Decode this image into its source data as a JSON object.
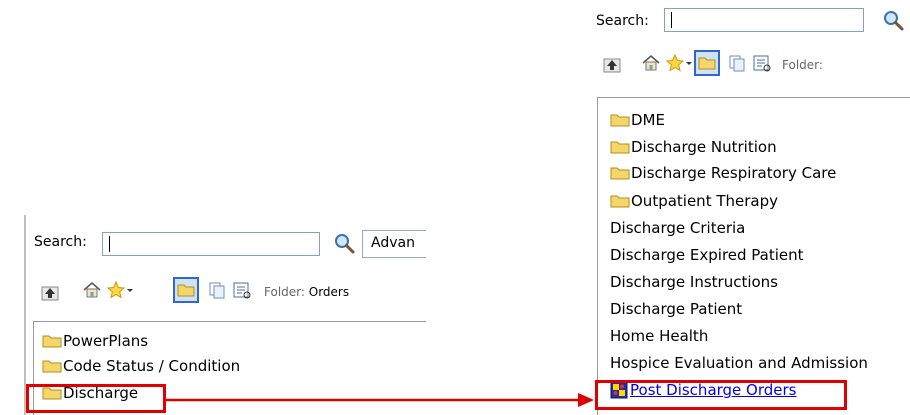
{
  "left_panel": {
    "search_label": "Search:",
    "search_value": "",
    "advanced_label": "Advan",
    "folder_label": "Folder:",
    "folder_value": "Orders",
    "items": [
      {
        "label": "PowerPlans",
        "icon": "folder-icon"
      },
      {
        "label": "Code Status / Condition",
        "icon": "folder-icon"
      },
      {
        "label": "Discharge",
        "icon": "folder-icon"
      }
    ]
  },
  "right_panel": {
    "search_label": "Search:",
    "search_value": "",
    "folder_label": "Folder:",
    "items": [
      {
        "label": "DME",
        "icon": "folder-icon"
      },
      {
        "label": "Discharge Nutrition",
        "icon": "folder-icon"
      },
      {
        "label": "Discharge Respiratory Care",
        "icon": "folder-icon"
      },
      {
        "label": "Outpatient Therapy",
        "icon": "folder-icon"
      },
      {
        "label": "Discharge Criteria",
        "icon": ""
      },
      {
        "label": "Discharge Expired Patient",
        "icon": ""
      },
      {
        "label": "Discharge Instructions",
        "icon": ""
      },
      {
        "label": "Discharge Patient",
        "icon": ""
      },
      {
        "label": "Home Health",
        "icon": ""
      },
      {
        "label": "Hospice Evaluation and Admission",
        "icon": ""
      },
      {
        "label": "Post Discharge Orders",
        "icon": "order-set-icon"
      }
    ]
  },
  "colors": {
    "highlight": "#e00000",
    "folder_fill": "#f5d66b",
    "link": "#0000ee"
  }
}
